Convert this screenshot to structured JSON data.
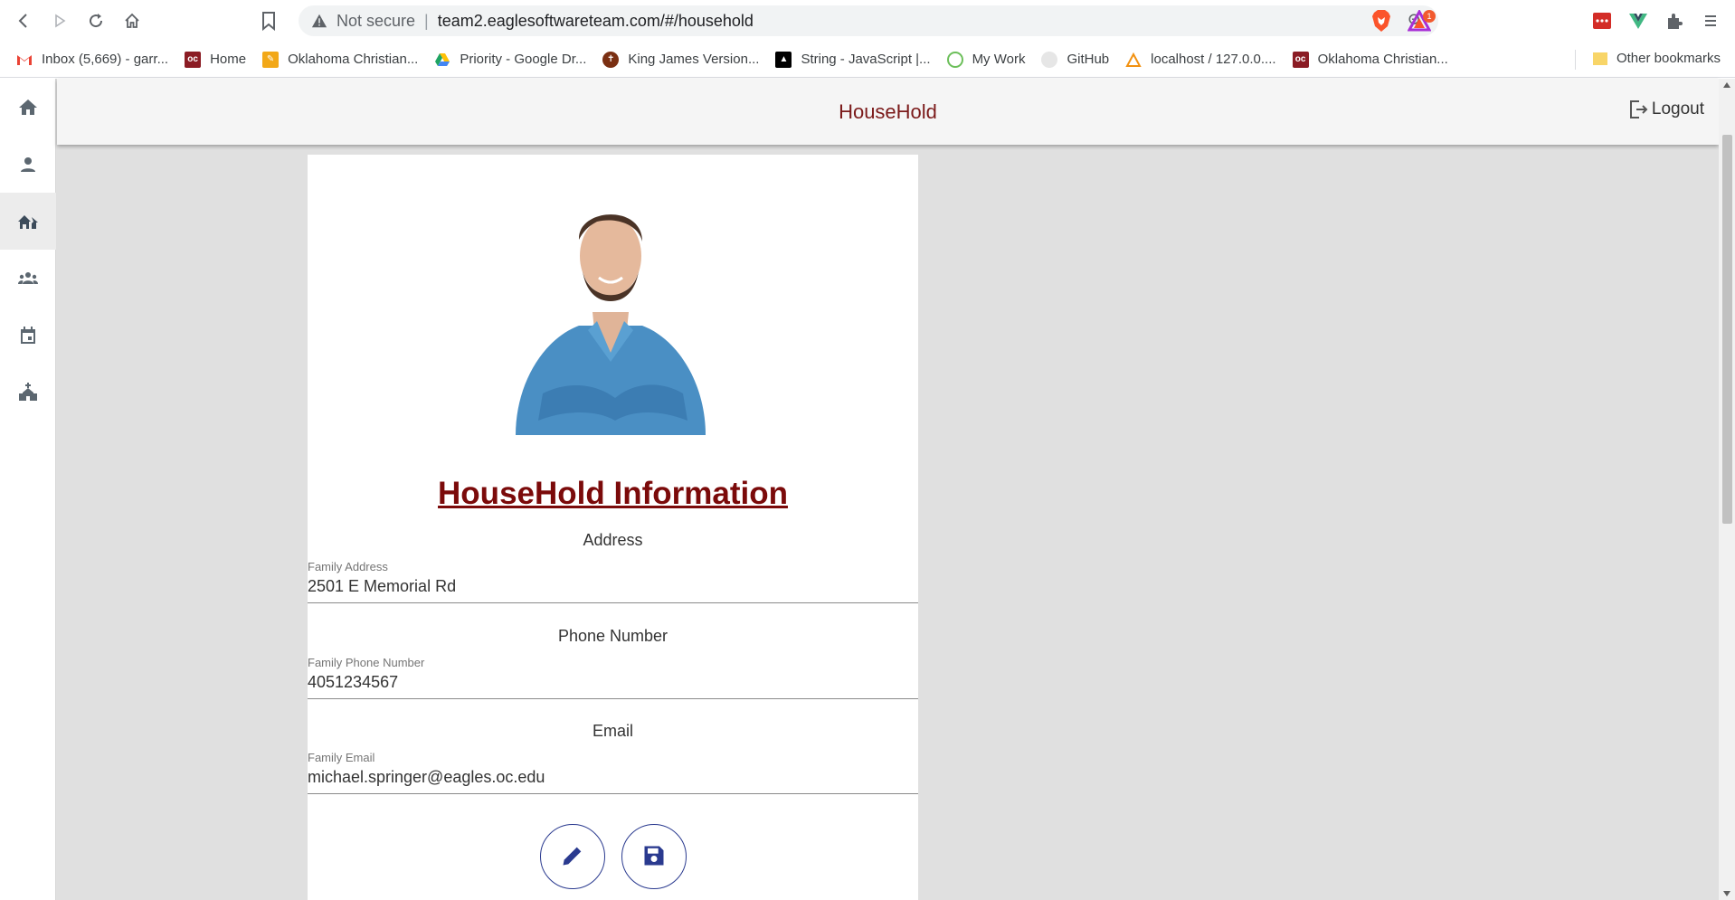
{
  "browser": {
    "not_secure": "Not secure",
    "url": "team2.eaglesoftwareteam.com/#/household",
    "rewards_badge": "1",
    "bookmarks": [
      {
        "label": "Inbox (5,669) - garr...",
        "icon": "gmail-icon",
        "color": "#ea4335"
      },
      {
        "label": "Home",
        "icon": "oc-icon",
        "color": "#8b1c24"
      },
      {
        "label": "Oklahoma Christian...",
        "icon": "pencil-icon",
        "color": "#f2a818"
      },
      {
        "label": "Priority - Google Dr...",
        "icon": "google-drive-icon",
        "color": "#1fa463"
      },
      {
        "label": "King James Version...",
        "icon": "bible-icon",
        "color": "#7a2f12"
      },
      {
        "label": "String - JavaScript |...",
        "icon": "mdn-icon",
        "color": "#000000"
      },
      {
        "label": "My Work",
        "icon": "target-icon",
        "color": "#6cbf5a"
      },
      {
        "label": "GitHub",
        "icon": "github-icon",
        "color": "#e6e6e6"
      },
      {
        "label": "localhost / 127.0.0....",
        "icon": "phpmyadmin-icon",
        "color": "#f29111"
      },
      {
        "label": "Oklahoma Christian...",
        "icon": "oc-icon",
        "color": "#8b1c24"
      }
    ],
    "other_bookmarks": "Other bookmarks"
  },
  "app": {
    "title": "HouseHold",
    "logout": "Logout",
    "accent_color": "#7b0a0a",
    "sidebar": [
      {
        "name": "home",
        "icon": "home-icon",
        "active": false
      },
      {
        "name": "person",
        "icon": "person-icon",
        "active": false
      },
      {
        "name": "household",
        "icon": "house-family-icon",
        "active": true
      },
      {
        "name": "groups",
        "icon": "groups-icon",
        "active": false
      },
      {
        "name": "calendar",
        "icon": "calendar-icon",
        "active": false
      },
      {
        "name": "church",
        "icon": "church-icon",
        "active": false
      }
    ]
  },
  "household": {
    "heading": "HouseHold Information",
    "address": {
      "section": "Address",
      "label": "Family Address",
      "value": "2501 E Memorial Rd"
    },
    "phone": {
      "section": "Phone Number",
      "label": "Family Phone Number",
      "value": "4051234567"
    },
    "email": {
      "section": "Email",
      "label": "Family Email",
      "value": "michael.springer@eagles.oc.edu"
    }
  }
}
